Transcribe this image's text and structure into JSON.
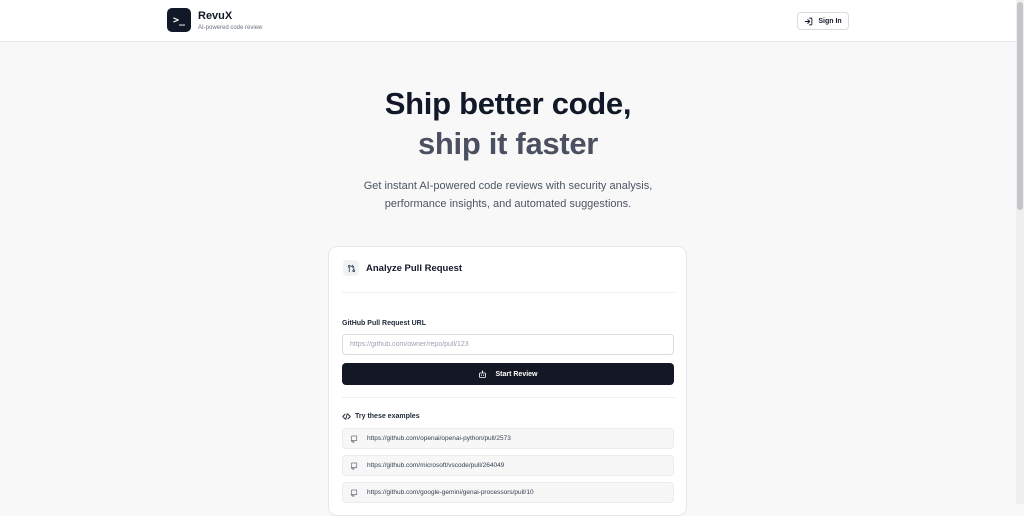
{
  "brand": {
    "logo_glyph": ">_",
    "name": "RevuX",
    "tagline": "AI-powered code review"
  },
  "header": {
    "signin_label": "Sign In",
    "signin_icon": "login-icon"
  },
  "hero": {
    "title_line1": "Ship better code,",
    "title_line2": "ship it faster",
    "subtitle_line1": "Get instant AI-powered code reviews with security analysis,",
    "subtitle_line2": "performance insights, and automated suggestions."
  },
  "card": {
    "title": "Analyze Pull Request",
    "title_icon": "git-pull-request-icon",
    "field_label": "GitHub Pull Request URL",
    "input_placeholder": "https://github.com/owner/repo/pull/123",
    "input_value": "",
    "start_button_label": "Start Review",
    "start_button_icon": "bot-icon",
    "examples_title": "Try these examples",
    "examples_icon": "code-icon",
    "examples": [
      "https://github.com/openai/openai-python/pull/2573",
      "https://github.com/microsoft/vscode/pull/264049",
      "https://github.com/google-gemini/genai-processors/pull/10"
    ]
  },
  "colors": {
    "primary": "#141824",
    "background": "#f8f8f9",
    "muted_heading": "#4b5060"
  }
}
